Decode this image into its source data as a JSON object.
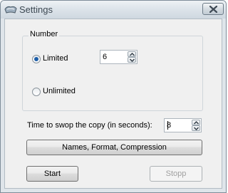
{
  "window": {
    "title": "Settings"
  },
  "number_group": {
    "legend": "Number",
    "limited_label": "Limited",
    "limited_value": "6",
    "unlimited_label": "Unlimited",
    "selected": "Limited"
  },
  "swap": {
    "label": "Time to swop the copy (in seconds):",
    "value": "8"
  },
  "buttons": {
    "names_format": "Names, Format, Compression",
    "start": "Start",
    "stop": "Stopp"
  },
  "icons": {
    "app": "settings-app-icon",
    "close": "close-icon",
    "spin_up": "chevron-up-icon",
    "spin_down": "chevron-down-icon"
  }
}
